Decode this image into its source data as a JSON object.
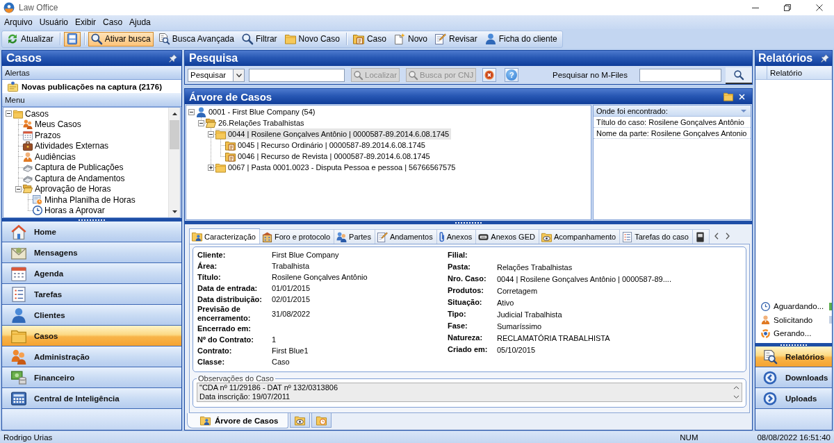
{
  "window": {
    "title": "Law Office"
  },
  "menu_bar": [
    "Arquivo",
    "Usuário",
    "Exibir",
    "Caso",
    "Ajuda"
  ],
  "toolbar": [
    {
      "kind": "button",
      "label": "Atualizar",
      "checked": false
    },
    {
      "kind": "separator"
    },
    {
      "kind": "button",
      "checked": true
    },
    {
      "kind": "separator"
    },
    {
      "kind": "button",
      "label": "Ativar busca",
      "checked": true
    },
    {
      "kind": "button",
      "label": "Busca Avançada",
      "checked": false
    },
    {
      "kind": "button",
      "label": "Filtrar",
      "checked": false
    },
    {
      "kind": "button",
      "label": "Novo Caso",
      "checked": false
    },
    {
      "kind": "separator"
    },
    {
      "kind": "button",
      "label": "Caso",
      "checked": false
    },
    {
      "kind": "button",
      "label": "Novo",
      "checked": false
    },
    {
      "kind": "button",
      "label": "Revisar",
      "checked": false
    },
    {
      "kind": "button",
      "label": "Ficha do cliente",
      "checked": false
    }
  ],
  "left_panel": {
    "title": "Casos",
    "alerts_title": "Alertas",
    "alerts": [
      {
        "text": "Novas publicações na captura (2176)"
      }
    ],
    "menu_title": "Menu",
    "menu_tree": [
      {
        "label": "Casos",
        "expanded": true,
        "children": [
          {
            "label": "Meus Casos"
          },
          {
            "label": "Prazos"
          },
          {
            "label": "Atividades Externas"
          },
          {
            "label": "Audiências"
          },
          {
            "label": "Captura de Publicações"
          },
          {
            "label": "Captura de Andamentos"
          },
          {
            "label": "Aprovação de Horas",
            "expanded": true,
            "children": [
              {
                "label": "Minha Planilha de Horas"
              },
              {
                "label": "Horas a Aprovar"
              }
            ]
          }
        ]
      }
    ]
  },
  "nav": [
    {
      "label": "Home",
      "selected": false
    },
    {
      "label": "Mensagens",
      "selected": false
    },
    {
      "label": "Agenda",
      "selected": false
    },
    {
      "label": "Tarefas",
      "selected": false
    },
    {
      "label": "Clientes",
      "selected": false
    },
    {
      "label": "Casos",
      "selected": true
    },
    {
      "label": "Administração",
      "selected": false
    },
    {
      "label": "Financeiro",
      "selected": false
    },
    {
      "label": "Central de Inteligência",
      "selected": false
    }
  ],
  "search_panel": {
    "title": "Pesquisa",
    "mode": "Pesquisar",
    "buttons": [
      {
        "kind": "labeled",
        "label": "Localizar",
        "disabled": true
      },
      {
        "kind": "labeled",
        "label": "Busca por CNJ",
        "disabled": true
      },
      {
        "kind": "icon",
        "disabled": false
      },
      {
        "kind": "glyph",
        "label": "?",
        "disabled": false
      }
    ],
    "mfiles_label": "Pesquisar no M-Files"
  },
  "case_tree_panel": {
    "title": "Árvore de Casos",
    "tree": [
      {
        "label": "0001 - First Blue Company (54)",
        "expanded": true,
        "selected": false,
        "children": [
          {
            "label": "26.Relações Trabalhistas",
            "expanded": true,
            "selected": false,
            "children": [
              {
                "label": "0044 | Rosilene Gonçalves Antônio | 0000587-89.2014.6.08.1745",
                "expanded": true,
                "selected": true,
                "children": [
                  {
                    "label": "0045 | Recurso Ordinário | 0000587-89.2014.6.08.1745",
                    "selected": false
                  },
                  {
                    "label": "0046 | Recurso de Revista | 0000587-89.2014.6.08.1745",
                    "selected": false
                  }
                ]
              },
              {
                "label": "0067 | Pasta 0001.0023 - Disputa Pessoa e pessoa | 56766567575",
                "expanded": false,
                "selected": false
              }
            ]
          }
        ]
      }
    ],
    "found_header": "Onde foi encontrado:",
    "found": [
      "Título do caso: Rosilene Gonçalves Antônio",
      "Nome da parte: Rosilene Gonçalves Antonio"
    ]
  },
  "detail_tabs": [
    {
      "label": "Caracterização",
      "selected": true
    },
    {
      "label": "Foro e protocolo",
      "selected": false
    },
    {
      "label": "Partes",
      "selected": false
    },
    {
      "label": "Andamentos",
      "selected": false
    },
    {
      "label": "Anexos",
      "selected": false
    },
    {
      "label": "Anexos GED",
      "selected": false
    },
    {
      "label": "Acompanhamento",
      "selected": false
    },
    {
      "label": "Tarefas do caso",
      "selected": false
    },
    {
      "selected": false
    }
  ],
  "details": {
    "left": [
      {
        "label": "Cliente:",
        "value": "First Blue Company"
      },
      {
        "label": "Área:",
        "value": "Trabalhista"
      },
      {
        "label": "Título:",
        "value": "Rosilene Gonçalves Antônio"
      },
      {
        "label": "Data de entrada:",
        "value": "01/01/2015"
      },
      {
        "label": "Data distribuição:",
        "value": "02/01/2015"
      },
      {
        "label": "Previsão de encerramento:",
        "value": "31/08/2022"
      },
      {
        "label": "Encerrado em:"
      },
      {
        "label": "Nº do Contrato:",
        "value": "1"
      },
      {
        "label": "Contrato:",
        "value": "First Blue1"
      },
      {
        "label": "Classe:",
        "value": "Caso"
      }
    ],
    "right": [
      {
        "label": "Filial:"
      },
      {
        "label": "Pasta:",
        "value": "Relações Trabalhistas"
      },
      {
        "label": "Nro. Caso:",
        "value": "0044 | Rosilene Gonçalves Antônio | 0000587-89...."
      },
      {
        "label": "Produtos:",
        "value": "Corretagem"
      },
      {
        "label": "Situação:",
        "value": "Ativo"
      },
      {
        "label": "Tipo:",
        "value": "Judicial Trabalhista"
      },
      {
        "label": "Fase:",
        "value": "Sumaríssimo"
      },
      {
        "label": "Natureza:",
        "value": "RECLAMATÓRIA TRABALHISTA"
      },
      {
        "label": "Criado em:",
        "value": "05/10/2015"
      }
    ]
  },
  "notes": {
    "title": "Observações do Caso",
    "text": "\"CDA nº 11/29186 - DAT nº 132/0313806\nData inscrição: 19/07/2011"
  },
  "bottom_tabs": [
    {
      "label": "Árvore de Casos",
      "selected": true
    },
    {
      "selected": false
    },
    {
      "selected": false
    }
  ],
  "reports_panel": {
    "title": "Relatórios",
    "column": "Relatório",
    "legend": [
      "Aguardando...",
      "Solicitando",
      "Gerando..."
    ]
  },
  "reports_nav": [
    {
      "label": "Relatórios",
      "selected": true
    },
    {
      "label": "Downloads",
      "selected": false
    },
    {
      "label": "Uploads",
      "selected": false
    }
  ],
  "status_bar": {
    "user": "Rodrigo Urias",
    "indicator": "NUM",
    "datetime": "08/08/2022 16:51:40"
  }
}
